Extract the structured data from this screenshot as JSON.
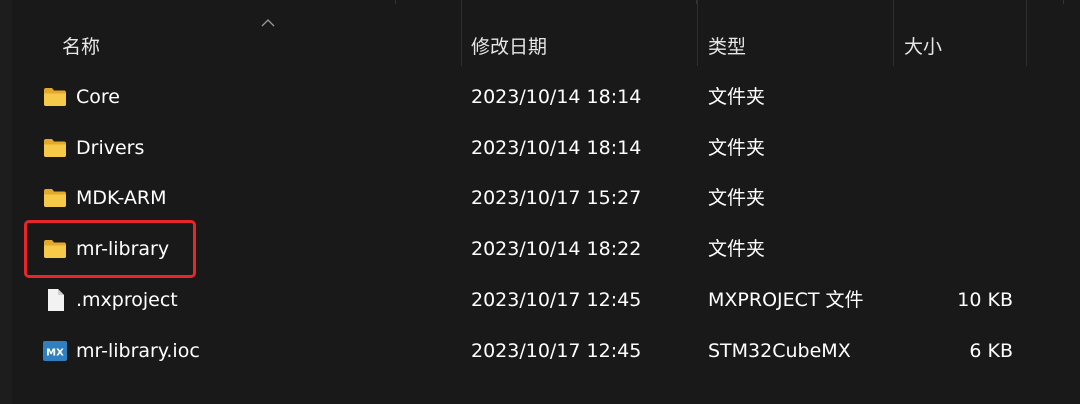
{
  "columns": {
    "name": "名称",
    "date": "修改日期",
    "type": "类型",
    "size": "大小"
  },
  "sort": {
    "column": "name",
    "direction": "ascending",
    "icon": "chevron-up-icon"
  },
  "files": [
    {
      "icon": "folder-icon",
      "name": "Core",
      "date": "2023/10/14 18:14",
      "type": "文件夹",
      "size": ""
    },
    {
      "icon": "folder-icon",
      "name": "Drivers",
      "date": "2023/10/14 18:14",
      "type": "文件夹",
      "size": ""
    },
    {
      "icon": "folder-icon",
      "name": "MDK-ARM",
      "date": "2023/10/17 15:27",
      "type": "文件夹",
      "size": ""
    },
    {
      "icon": "folder-icon",
      "name": "mr-library",
      "date": "2023/10/14 18:22",
      "type": "文件夹",
      "size": "",
      "highlighted": true
    },
    {
      "icon": "file-icon",
      "name": ".mxproject",
      "date": "2023/10/17 12:45",
      "type": "MXPROJECT 文件",
      "size": "10 KB"
    },
    {
      "icon": "stm32cubemx-icon",
      "name": "mr-library.ioc",
      "date": "2023/10/17 12:45",
      "type": "STM32CubeMX",
      "size": "6 KB",
      "badge_text": "MX"
    }
  ],
  "colors": {
    "background": "#191919",
    "highlight": "#e8262a",
    "folder": "#f7c948",
    "mx_badge": "#2f7fc1"
  }
}
